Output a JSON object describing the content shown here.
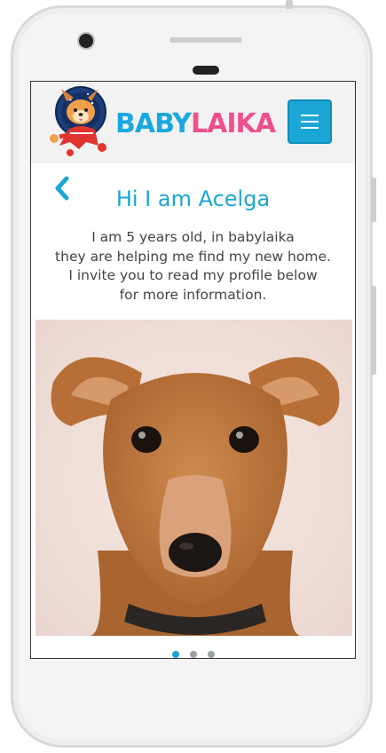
{
  "brand": {
    "baby": "BABY",
    "laika": "LAIKA",
    "baby_color": "#1aa8df",
    "laika_color": "#ef4f8c"
  },
  "header": {
    "menu_icon": "hamburger-icon"
  },
  "profile": {
    "title": "Hi I am Acelga",
    "intro_lines": [
      "I am 5 years old, in babylaika",
      "they are helping me find my new home.",
      "I invite you to read my profile below",
      "for more information."
    ]
  },
  "carousel": {
    "slides": 3,
    "active_index": 0
  },
  "colors": {
    "accent": "#1ba6d6"
  }
}
